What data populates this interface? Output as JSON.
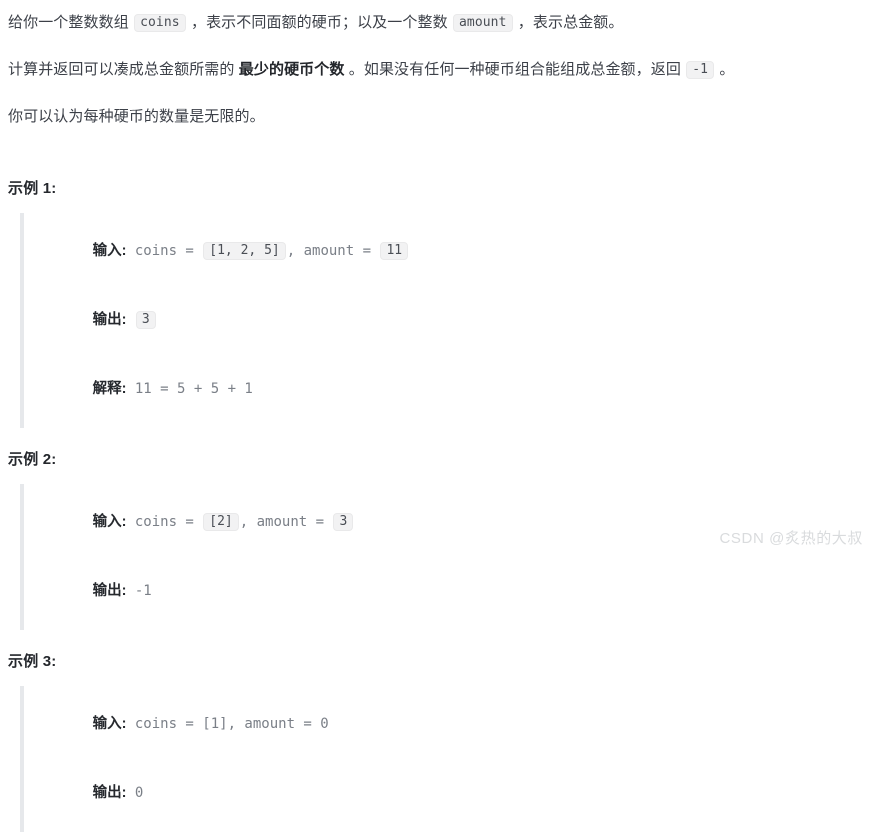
{
  "document": {
    "type": "algorithm-problem-statement",
    "language": "zh-CN"
  },
  "description": {
    "paragraph1": {
      "seg1": "给你一个整数数组 ",
      "code1": "coins",
      "seg2": " ，表示不同面额的硬币；以及一个整数 ",
      "code2": "amount",
      "seg3": " ，表示总金额。"
    },
    "paragraph2": {
      "seg1": "计算并返回可以凑成总金额所需的 ",
      "bold": "最少的硬币个数",
      "seg2": " 。如果没有任何一种硬币组合能组成总金额，返回 ",
      "code1": "-1",
      "seg3": " 。"
    },
    "paragraph3": {
      "text": "你可以认为每种硬币的数量是无限的。"
    }
  },
  "examples": [
    {
      "heading": "示例 1:",
      "lines": [
        {
          "label": "输入:",
          "parts": [
            {
              "kind": "text",
              "text": " coins = "
            },
            {
              "kind": "code",
              "text": "[1, 2, 5]"
            },
            {
              "kind": "text",
              "text": ", amount = "
            },
            {
              "kind": "code",
              "text": "11"
            }
          ]
        },
        {
          "label": "输出:",
          "parts": [
            {
              "kind": "text",
              "text": " "
            },
            {
              "kind": "code",
              "text": "3"
            }
          ]
        },
        {
          "label": "解释:",
          "parts": [
            {
              "kind": "text",
              "text": " 11 = 5 + 5 + 1"
            }
          ]
        }
      ]
    },
    {
      "heading": "示例 2:",
      "lines": [
        {
          "label": "输入:",
          "parts": [
            {
              "kind": "text",
              "text": " coins = "
            },
            {
              "kind": "code",
              "text": "[2]"
            },
            {
              "kind": "text",
              "text": ", amount = "
            },
            {
              "kind": "code",
              "text": "3"
            }
          ]
        },
        {
          "label": "输出:",
          "parts": [
            {
              "kind": "text",
              "text": " -1"
            }
          ]
        }
      ]
    },
    {
      "heading": "示例 3:",
      "lines": [
        {
          "label": "输入:",
          "parts": [
            {
              "kind": "text",
              "text": " coins = [1], amount = 0"
            }
          ]
        },
        {
          "label": "输出:",
          "parts": [
            {
              "kind": "text",
              "text": " 0"
            }
          ]
        }
      ]
    }
  ],
  "watermark": {
    "text": "CSDN @炙热的大叔",
    "color": "#d9dbdd"
  },
  "colors": {
    "background": "#ffffff",
    "body_text": "#3c4048",
    "strong_text": "#23262b",
    "code_background": "#f2f2f3",
    "code_border": "#e9e9ea",
    "code_text": "#4a4e55",
    "mono_text": "#7a7f87",
    "example_border": "#e6e8eb"
  }
}
